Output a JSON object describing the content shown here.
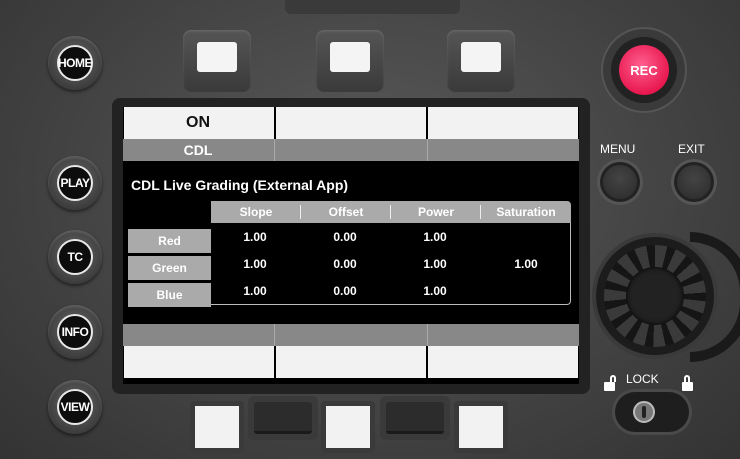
{
  "left_buttons": [
    {
      "label": "HOME"
    },
    {
      "label": "PLAY"
    },
    {
      "label": "TC"
    },
    {
      "label": "INFO"
    },
    {
      "label": "VIEW"
    }
  ],
  "screen": {
    "function_on_label": "ON",
    "menu_name": "CDL",
    "title": "CDL Live Grading  (External App)",
    "table": {
      "columns": [
        "Slope",
        "Offset",
        "Power",
        "Saturation"
      ],
      "rows": [
        {
          "label": "Red",
          "slope": "1.00",
          "offset": "0.00",
          "power": "1.00"
        },
        {
          "label": "Green",
          "slope": "1.00",
          "offset": "0.00",
          "power": "1.00"
        },
        {
          "label": "Blue",
          "slope": "1.00",
          "offset": "0.00",
          "power": "1.00"
        }
      ],
      "saturation": "1.00"
    }
  },
  "right_controls": {
    "rec_label": "REC",
    "menu_label": "MENU",
    "exit_label": "EXIT",
    "lock_label": "LOCK"
  },
  "colors": {
    "rec": "#e8184f",
    "screen_bg": "#000000",
    "cell_bg": "#f2f2f2",
    "header_bg": "#aaaaaa"
  },
  "icons": [
    "padlock-open-icon",
    "padlock-closed-icon",
    "jog-dial-icon"
  ]
}
